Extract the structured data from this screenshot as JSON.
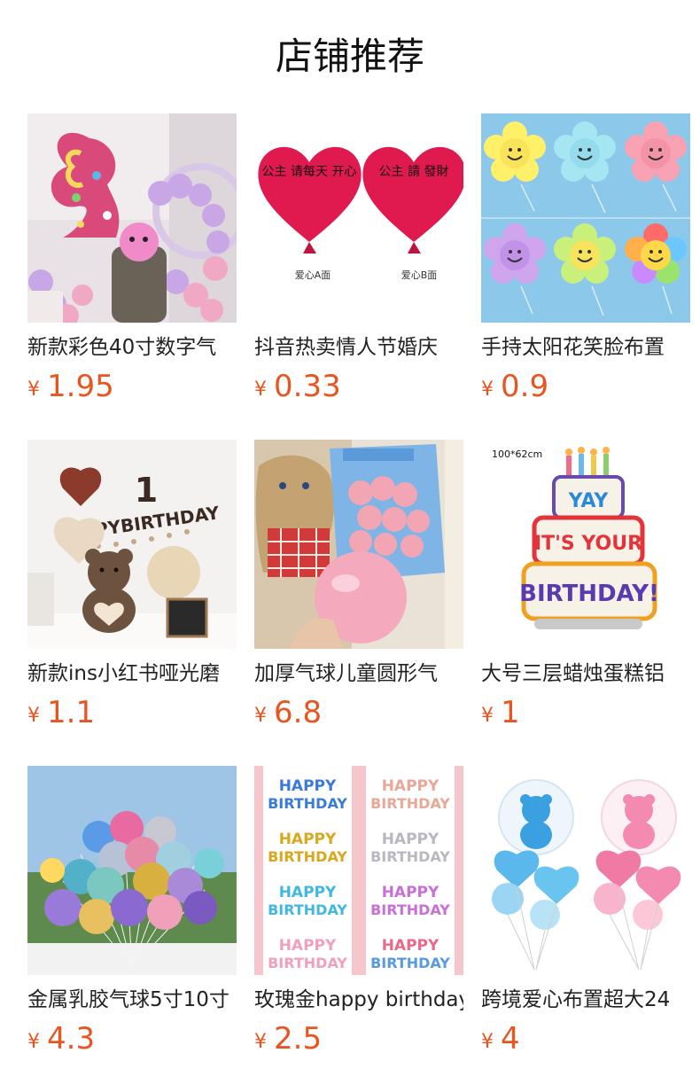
{
  "page_title": "店铺推荐",
  "currency_symbol": "¥",
  "colors": {
    "price": "#e8551f",
    "text": "#222222"
  },
  "products": [
    {
      "name": "新款彩色40寸数字气",
      "price": "1.95"
    },
    {
      "name": "抖音热卖情人节婚庆",
      "price": "0.33",
      "image_text": {
        "left_heart": "公主 请每天 开心",
        "right_heart": "公主 請 發財",
        "label_a": "爱心A面",
        "label_b": "爱心B面"
      }
    },
    {
      "name": "手持太阳花笑脸布置",
      "price": "0.9"
    },
    {
      "name": "新款ins小红书哑光磨",
      "price": "1.1",
      "image_text": {
        "number": "1",
        "banner": "PPYBIRTHDAY"
      }
    },
    {
      "name": "加厚气球儿童圆形气",
      "price": "6.8"
    },
    {
      "name": "大号三层蜡烛蛋糕铝",
      "price": "1",
      "image_text": {
        "size": "100*62cm",
        "tier1": "YAY",
        "tier2": "IT'S YOUR",
        "tier3": "BIRTHDAY!"
      }
    },
    {
      "name": "金属乳胶气球5寸10寸",
      "price": "4.3"
    },
    {
      "name": "玫瑰金happy birthday",
      "price": "2.5",
      "image_text": {
        "word1": "HAPPY",
        "word2": "BIRTHDAY"
      }
    },
    {
      "name": "跨境爱心布置超大24",
      "price": "4"
    }
  ]
}
